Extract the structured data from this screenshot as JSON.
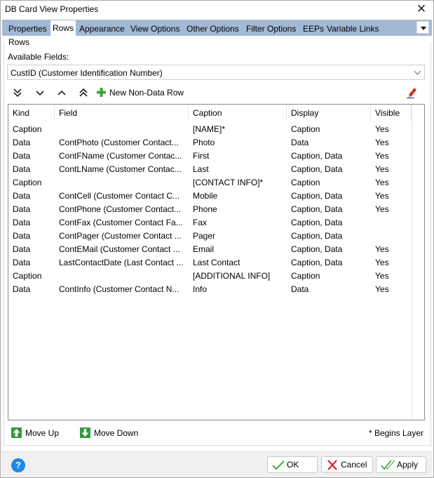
{
  "window": {
    "title": "DB Card View Properties",
    "close_icon": "close-icon"
  },
  "tabs": [
    {
      "label": "Properties",
      "active": false
    },
    {
      "label": "Rows",
      "active": true
    },
    {
      "label": "Appearance",
      "active": false
    },
    {
      "label": "View Options",
      "active": false
    },
    {
      "label": "Other Options",
      "active": false
    },
    {
      "label": "Filter Options",
      "active": false
    },
    {
      "label": "EEPs",
      "active": false
    },
    {
      "label": "Variable Links",
      "active": false
    }
  ],
  "rows_panel": {
    "group_title": "Rows",
    "available_fields_label": "Available Fields:",
    "available_fields_value": "CustID  (Customer Identification Number)",
    "toolbar": {
      "move_bottom_icon": "double-chevron-down-icon",
      "move_down_icon": "chevron-down-icon",
      "move_up_icon": "chevron-up-icon",
      "move_top_icon": "double-chevron-up-icon",
      "new_row_label": "New Non-Data Row",
      "new_row_icon": "plus-icon",
      "edit_icon": "pencil-icon"
    },
    "grid": {
      "columns": [
        "Kind",
        "Field",
        "Caption",
        "Display",
        "Visible"
      ],
      "rows": [
        {
          "kind": "Caption",
          "field": "",
          "caption": "[NAME]*",
          "display": "Caption",
          "visible": "Yes"
        },
        {
          "kind": "Data",
          "field": "ContPhoto  (Customer Contact...",
          "caption": "Photo",
          "display": "Data",
          "visible": "Yes"
        },
        {
          "kind": "Data",
          "field": "ContFName  (Customer Contac...",
          "caption": "First",
          "display": "Caption, Data",
          "visible": "Yes"
        },
        {
          "kind": "Data",
          "field": "ContLName  (Customer Contac...",
          "caption": "Last",
          "display": "Caption, Data",
          "visible": "Yes"
        },
        {
          "kind": "Caption",
          "field": "",
          "caption": "[CONTACT INFO]*",
          "display": "Caption",
          "visible": "Yes"
        },
        {
          "kind": "Data",
          "field": "ContCell  (Customer Contact C...",
          "caption": "Mobile",
          "display": "Caption, Data",
          "visible": "Yes"
        },
        {
          "kind": "Data",
          "field": "ContPhone  (Customer Contact...",
          "caption": "Phone",
          "display": "Caption, Data",
          "visible": "Yes"
        },
        {
          "kind": "Data",
          "field": "ContFax  (Customer Contact Fa...",
          "caption": "Fax",
          "display": "Caption, Data",
          "visible": ""
        },
        {
          "kind": "Data",
          "field": "ContPager  (Customer Contact ...",
          "caption": "Pager",
          "display": "Caption, Data",
          "visible": ""
        },
        {
          "kind": "Data",
          "field": "ContEMail  (Customer Contact ...",
          "caption": "Email",
          "display": "Caption, Data",
          "visible": "Yes"
        },
        {
          "kind": "Data",
          "field": "LastContactDate  (Last Contact ...",
          "caption": "Last Contact",
          "display": "Caption, Data",
          "visible": "Yes"
        },
        {
          "kind": "Caption",
          "field": "",
          "caption": "[ADDITIONAL INFO]",
          "display": "Caption",
          "visible": "Yes"
        },
        {
          "kind": "Data",
          "field": "ContInfo  (Customer Contact N...",
          "caption": "Info",
          "display": "Data",
          "visible": "Yes"
        }
      ]
    },
    "move_up_label": "Move Up",
    "move_down_label": "Move Down",
    "begins_layer_note": "* Begins Layer"
  },
  "footer": {
    "help_label": "?",
    "ok_label": "OK",
    "cancel_label": "Cancel",
    "apply_label": "Apply"
  },
  "colors": {
    "tabbar_bg": "#a3b9d3",
    "accent_green": "#2e9d3a",
    "cancel_red": "#e02020",
    "help_blue": "#1e88e5"
  }
}
